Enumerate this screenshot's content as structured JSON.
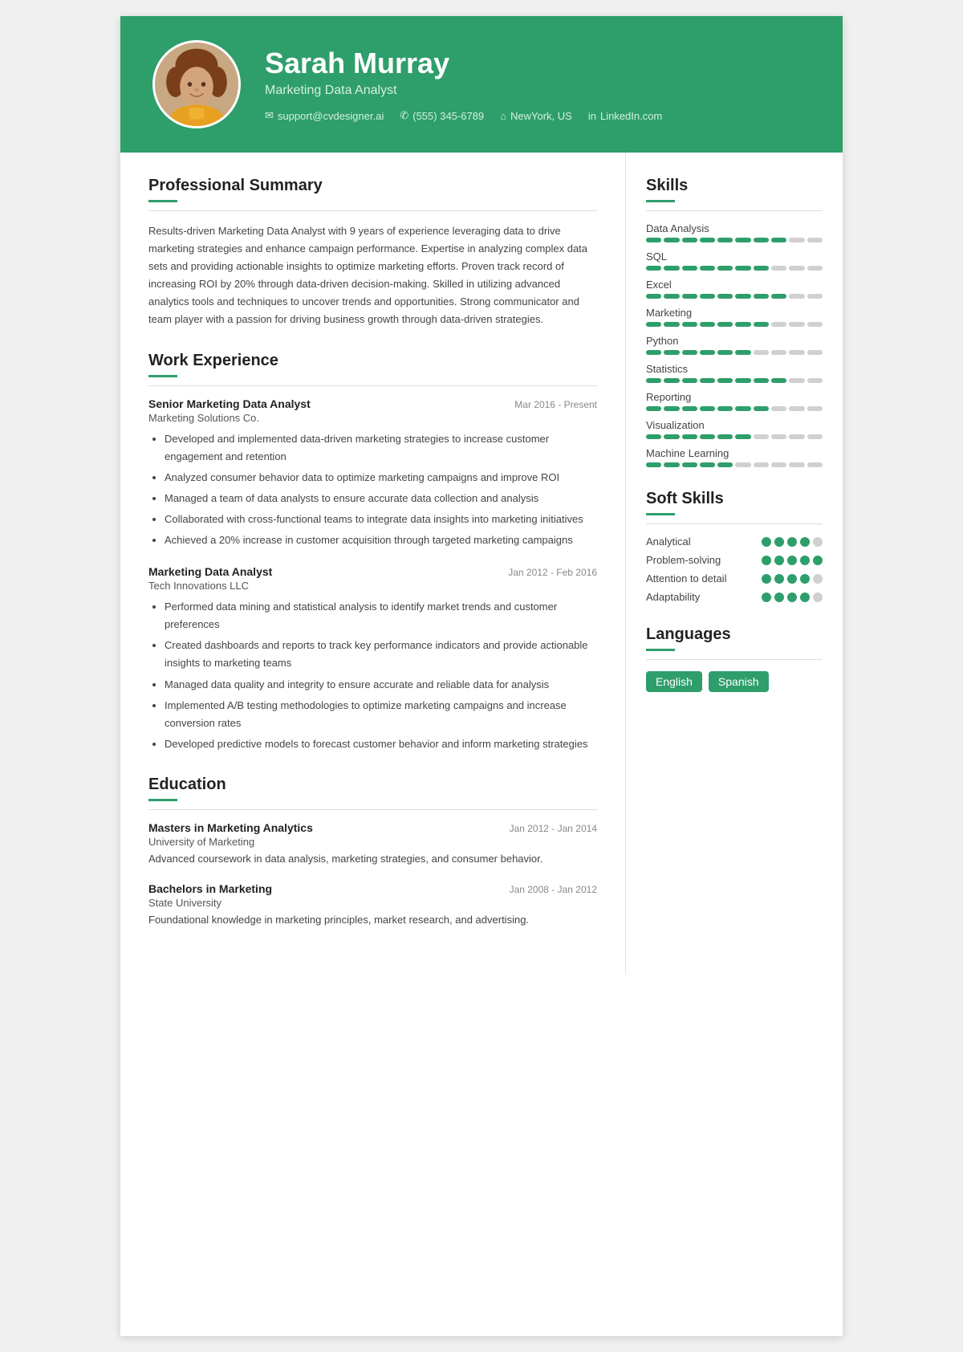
{
  "header": {
    "name": "Sarah Murray",
    "title": "Marketing Data Analyst",
    "contacts": [
      {
        "icon": "email-icon",
        "text": "support@cvdesigner.ai"
      },
      {
        "icon": "phone-icon",
        "text": "(555) 345-6789"
      },
      {
        "icon": "location-icon",
        "text": "NewYork, US"
      },
      {
        "icon": "linkedin-icon",
        "text": "LinkedIn.com"
      }
    ]
  },
  "sections": {
    "summary": {
      "title": "Professional Summary",
      "text": "Results-driven Marketing Data Analyst with 9 years of experience leveraging data to drive marketing strategies and enhance campaign performance. Expertise in analyzing complex data sets and providing actionable insights to optimize marketing efforts. Proven track record of increasing ROI by 20% through data-driven decision-making. Skilled in utilizing advanced analytics tools and techniques to uncover trends and opportunities. Strong communicator and team player with a passion for driving business growth through data-driven strategies."
    },
    "work_experience": {
      "title": "Work Experience",
      "jobs": [
        {
          "title": "Senior Marketing Data Analyst",
          "company": "Marketing Solutions Co.",
          "date": "Mar 2016 - Present",
          "bullets": [
            "Developed and implemented data-driven marketing strategies to increase customer engagement and retention",
            "Analyzed consumer behavior data to optimize marketing campaigns and improve ROI",
            "Managed a team of data analysts to ensure accurate data collection and analysis",
            "Collaborated with cross-functional teams to integrate data insights into marketing initiatives",
            "Achieved a 20% increase in customer acquisition through targeted marketing campaigns"
          ]
        },
        {
          "title": "Marketing Data Analyst",
          "company": "Tech Innovations LLC",
          "date": "Jan 2012 - Feb 2016",
          "bullets": [
            "Performed data mining and statistical analysis to identify market trends and customer preferences",
            "Created dashboards and reports to track key performance indicators and provide actionable insights to marketing teams",
            "Managed data quality and integrity to ensure accurate and reliable data for analysis",
            "Implemented A/B testing methodologies to optimize marketing campaigns and increase conversion rates",
            "Developed predictive models to forecast customer behavior and inform marketing strategies"
          ]
        }
      ]
    },
    "education": {
      "title": "Education",
      "items": [
        {
          "degree": "Masters in Marketing Analytics",
          "school": "University of Marketing",
          "date": "Jan 2012 - Jan 2014",
          "desc": "Advanced coursework in data analysis, marketing strategies, and consumer behavior."
        },
        {
          "degree": "Bachelors in Marketing",
          "school": "State University",
          "date": "Jan 2008 - Jan 2012",
          "desc": "Foundational knowledge in marketing principles, market research, and advertising."
        }
      ]
    }
  },
  "right": {
    "skills": {
      "title": "Skills",
      "items": [
        {
          "name": "Data Analysis",
          "filled": 8,
          "total": 10
        },
        {
          "name": "SQL",
          "filled": 7,
          "total": 10
        },
        {
          "name": "Excel",
          "filled": 8,
          "total": 10
        },
        {
          "name": "Marketing",
          "filled": 7,
          "total": 10
        },
        {
          "name": "Python",
          "filled": 6,
          "total": 10
        },
        {
          "name": "Statistics",
          "filled": 8,
          "total": 10
        },
        {
          "name": "Reporting",
          "filled": 7,
          "total": 10
        },
        {
          "name": "Visualization",
          "filled": 6,
          "total": 10
        },
        {
          "name": "Machine Learning",
          "filled": 5,
          "total": 10
        }
      ]
    },
    "soft_skills": {
      "title": "Soft Skills",
      "items": [
        {
          "name": "Analytical",
          "filled": 4,
          "total": 5
        },
        {
          "name": "Problem-solving",
          "filled": 5,
          "total": 5
        },
        {
          "name": "Attention to detail",
          "filled": 4,
          "total": 5
        },
        {
          "name": "Adaptability",
          "filled": 4,
          "total": 5
        }
      ]
    },
    "languages": {
      "title": "Languages",
      "items": [
        "English",
        "Spanish"
      ]
    }
  }
}
